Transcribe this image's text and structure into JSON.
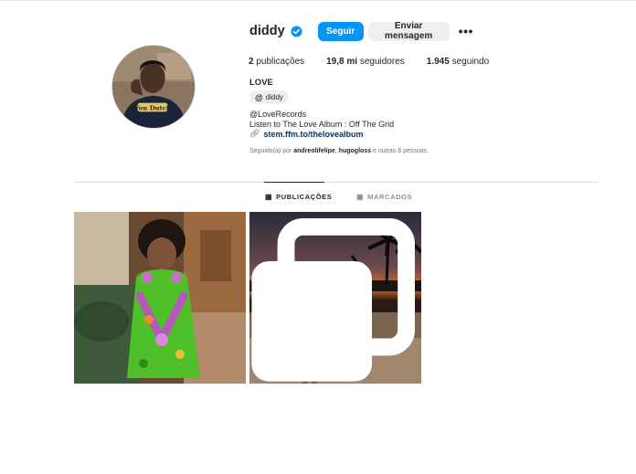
{
  "profile": {
    "username": "diddy",
    "follow_label": "Seguir",
    "message_label": "Enviar mensagem",
    "more_label": "•••"
  },
  "stats": {
    "posts_count": "2",
    "posts_label": "publicações",
    "followers_count": "19,8 mi",
    "followers_label": "seguidores",
    "following_count": "1.945",
    "following_label": "seguindo"
  },
  "bio": {
    "name": "LOVE",
    "threads_handle": "diddy",
    "line1": "@LoveRecords",
    "line2": "Listen to The Love Album : Off The Grid",
    "link": "stem.ffm.to/thelovealbum"
  },
  "followed_by": {
    "prefix": "Seguido(a) por",
    "user1": "andreolifelipe",
    "sep": ",",
    "user2": "hugogloss",
    "suffix": "e outras 8 pessoas"
  },
  "tabs": [
    {
      "label": "PUBLICAÇÕES",
      "icon": "grid-icon",
      "active": true
    },
    {
      "label": "MARCADOS",
      "icon": "tagged-icon",
      "active": false
    }
  ],
  "colors": {
    "accent": "#0095f6",
    "link": "#00376b",
    "text": "#262626",
    "muted": "#737373"
  }
}
